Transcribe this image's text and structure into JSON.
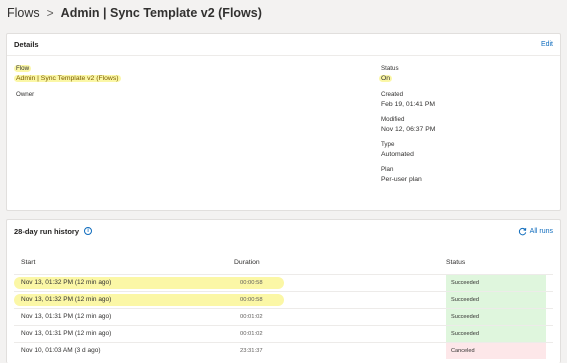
{
  "breadcrumb": {
    "root": "Flows",
    "separator": ">",
    "current": "Admin | Sync Template v2 (Flows)"
  },
  "details": {
    "title": "Details",
    "edit_label": "Edit",
    "flow_label": "Flow",
    "flow_value": "Admin | Sync Template v2 (Flows)",
    "owner_label": "Owner",
    "status_label": "Status",
    "status_value": "On",
    "created_label": "Created",
    "created_value": "Feb 19, 01:41 PM",
    "modified_label": "Modified",
    "modified_value": "Nov 12, 06:37 PM",
    "type_label": "Type",
    "type_value": "Automated",
    "plan_label": "Plan",
    "plan_value": "Per-user plan"
  },
  "history": {
    "title": "28-day run history",
    "info_icon": "info-icon",
    "all_runs_label": "All runs",
    "refresh_icon": "refresh-icon",
    "columns": {
      "start": "Start",
      "duration": "Duration",
      "status": "Status"
    },
    "rows": [
      {
        "start": "Nov 13, 01:32 PM (12 min ago)",
        "duration": "00:00:58",
        "status": "Succeeded"
      },
      {
        "start": "Nov 13, 01:32 PM (12 min ago)",
        "duration": "00:00:58",
        "status": "Succeeded"
      },
      {
        "start": "Nov 13, 01:31 PM (12 min ago)",
        "duration": "00:01:02",
        "status": "Succeeded"
      },
      {
        "start": "Nov 13, 01:31 PM (12 min ago)",
        "duration": "00:01:02",
        "status": "Succeeded"
      },
      {
        "start": "Nov 10, 01:03 AM (3 d ago)",
        "duration": "23:31:37",
        "status": "Canceled"
      }
    ]
  },
  "colors": {
    "accent": "#0f6cbd",
    "highlight": "#fbf7a6",
    "succeeded_bg": "#dff6dd",
    "canceled_bg": "#fde7e9"
  }
}
